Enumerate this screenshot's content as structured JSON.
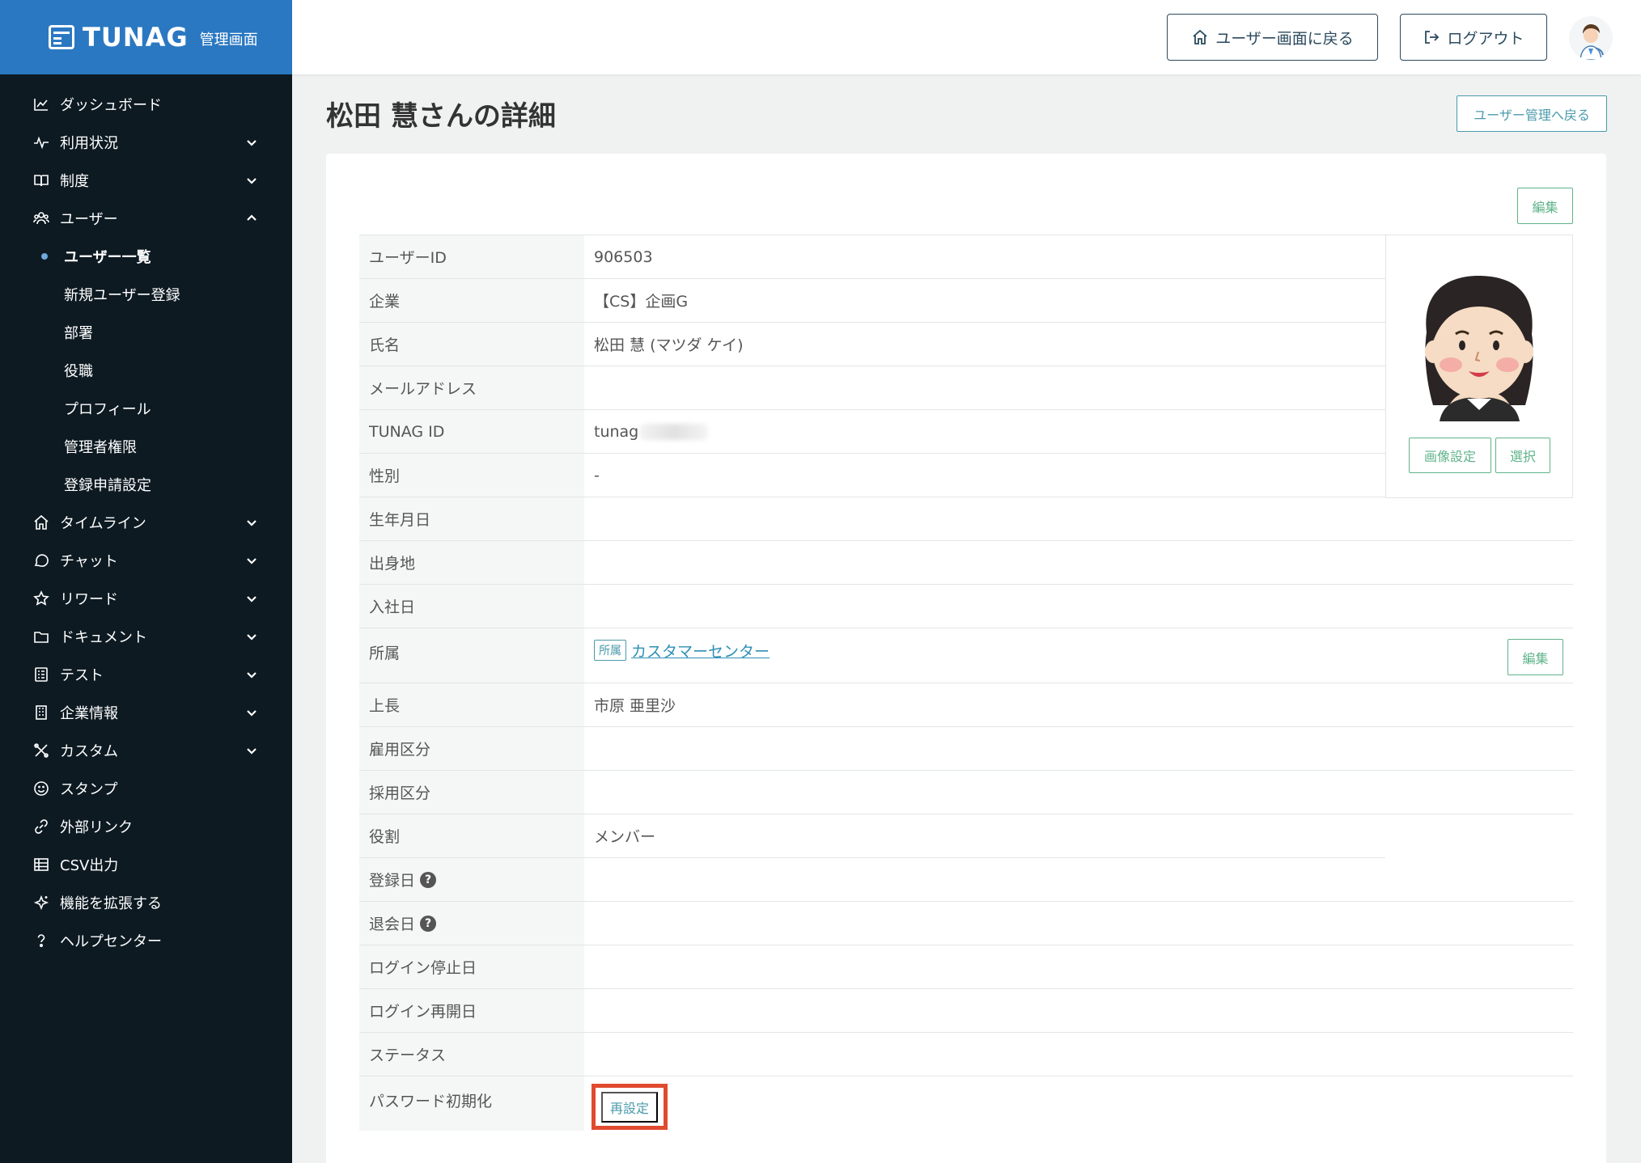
{
  "brand": {
    "name": "TUNAG",
    "subtitle": "管理画面"
  },
  "sidebar": {
    "items": [
      {
        "label": "ダッシュボード",
        "icon": "chart-line-icon",
        "expandable": false
      },
      {
        "label": "利用状況",
        "icon": "pulse-icon",
        "expandable": true
      },
      {
        "label": "制度",
        "icon": "book-icon",
        "expandable": true
      },
      {
        "label": "ユーザー",
        "icon": "users-icon",
        "expandable": true,
        "expanded": true
      },
      {
        "label": "タイムライン",
        "icon": "home-icon",
        "expandable": true
      },
      {
        "label": "チャット",
        "icon": "chat-icon",
        "expandable": true
      },
      {
        "label": "リワード",
        "icon": "star-icon",
        "expandable": true
      },
      {
        "label": "ドキュメント",
        "icon": "folder-icon",
        "expandable": true
      },
      {
        "label": "テスト",
        "icon": "checklist-icon",
        "expandable": true
      },
      {
        "label": "企業情報",
        "icon": "building-icon",
        "expandable": true
      },
      {
        "label": "カスタム",
        "icon": "tools-icon",
        "expandable": true
      },
      {
        "label": "スタンプ",
        "icon": "smile-icon",
        "expandable": false
      },
      {
        "label": "外部リンク",
        "icon": "link-icon",
        "expandable": false
      },
      {
        "label": "CSV出力",
        "icon": "table-icon",
        "expandable": false
      },
      {
        "label": "機能を拡張する",
        "icon": "sparkle-icon",
        "expandable": false
      },
      {
        "label": "ヘルプセンター",
        "icon": "help-icon",
        "expandable": false
      }
    ],
    "user_sub": [
      "ユーザー一覧",
      "新規ユーザー登録",
      "部署",
      "役職",
      "プロフィール",
      "管理者権限",
      "登録申請設定"
    ]
  },
  "header": {
    "back_to_user": "ユーザー画面に戻る",
    "logout": "ログアウト"
  },
  "page": {
    "title": "松田 慧さんの詳細",
    "back_button": "ユーザー管理へ戻る",
    "edit": "編集"
  },
  "photo": {
    "set_image": "画像設定",
    "select": "選択"
  },
  "details": {
    "user_id": {
      "label": "ユーザーID",
      "value": "906503"
    },
    "company": {
      "label": "企業",
      "value": "【CS】企画G"
    },
    "name": {
      "label": "氏名",
      "value": "松田 慧 (マツダ ケイ)"
    },
    "email": {
      "label": "メールアドレス",
      "value": ""
    },
    "tunag_id": {
      "label": "TUNAG ID",
      "value": "tunag"
    },
    "gender": {
      "label": "性別",
      "value": "-"
    },
    "birthday": {
      "label": "生年月日",
      "value": ""
    },
    "hometown": {
      "label": "出身地",
      "value": ""
    },
    "joined": {
      "label": "入社日",
      "value": ""
    },
    "department": {
      "label": "所属",
      "tag": "所属",
      "value": "カスタマーセンター",
      "edit": "編集"
    },
    "boss": {
      "label": "上長",
      "value": "市原 亜里沙"
    },
    "employment": {
      "label": "雇用区分",
      "value": ""
    },
    "hiring": {
      "label": "採用区分",
      "value": ""
    },
    "role": {
      "label": "役割",
      "value": "メンバー"
    },
    "registered": {
      "label": "登録日",
      "value": ""
    },
    "left": {
      "label": "退会日",
      "value": ""
    },
    "login_stop": {
      "label": "ログイン停止日",
      "value": ""
    },
    "login_resume": {
      "label": "ログイン再開日",
      "value": ""
    },
    "status": {
      "label": "ステータス",
      "value": ""
    },
    "password": {
      "label": "パスワード初期化",
      "button": "再設定"
    }
  },
  "colors": {
    "brand": "#2b78c2",
    "sidebar": "#0d1a22",
    "accent_green": "#5fb38a",
    "accent_teal": "#4a9aab",
    "highlight": "#e04a2f"
  }
}
